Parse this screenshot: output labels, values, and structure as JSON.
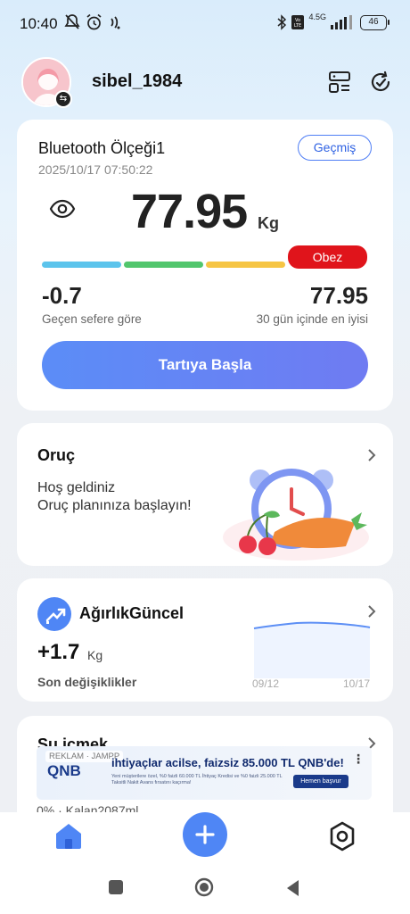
{
  "status_bar": {
    "time": "10:40",
    "left_icons": [
      "mute-icon",
      "alarm-icon",
      "signal-wave-icon"
    ],
    "right_icons": [
      "bluetooth-icon",
      "volte-icon",
      "signal-icon"
    ],
    "network": "4.5G",
    "battery": "46"
  },
  "header": {
    "username": "sibel_1984",
    "icons": [
      "devices-icon",
      "sync-icon"
    ]
  },
  "scale_card": {
    "device_name": "Bluetooth Ölçeği1",
    "timestamp": "2025/10/17 07:50:22",
    "history_label": "Geçmiş",
    "weight": "77.95",
    "unit": "Kg",
    "bmi_status": "Obez",
    "bmi_colors": [
      "#5cc4ec",
      "#52c66d",
      "#f6c544",
      "#e0141b"
    ],
    "change_value": "-0.7",
    "change_label": "Geçen sefere göre",
    "best_value": "77.95",
    "best_label": "30 gün içinde en iyisi",
    "start_label": "Tartıya Başla"
  },
  "fasting_card": {
    "title": "Oruç",
    "line1": "Hoş geldiniz",
    "line2": "Oruç planınıza başlayın!"
  },
  "weight_card": {
    "title": "AğırlıkGüncel",
    "change": "+1.7",
    "unit": "Kg",
    "subtitle": "Son değişiklikler",
    "date_start": "09/12",
    "date_end": "10/17"
  },
  "water_card": {
    "title": "Su içmek",
    "status": "0% · Kalan2087ml",
    "ad": {
      "tag": "REKLAM · JAMPP",
      "logo": "QNB",
      "headline": "ihtiyaçlar acilse, faizsiz 85.000 TL QNB'de!",
      "fine_print": "Yeni müşterilere özel, %0 faizli 60.000 TL İhtiyaç Kredisi ve %0 faizli 25.000 TL Taksitli Nakit Avans fırsatını kaçırma!",
      "cta": "Hemen başvur"
    }
  },
  "bottom_nav": {
    "items": [
      "home-icon",
      "add-icon",
      "settings-icon"
    ],
    "active_color": "#4f86f5"
  }
}
